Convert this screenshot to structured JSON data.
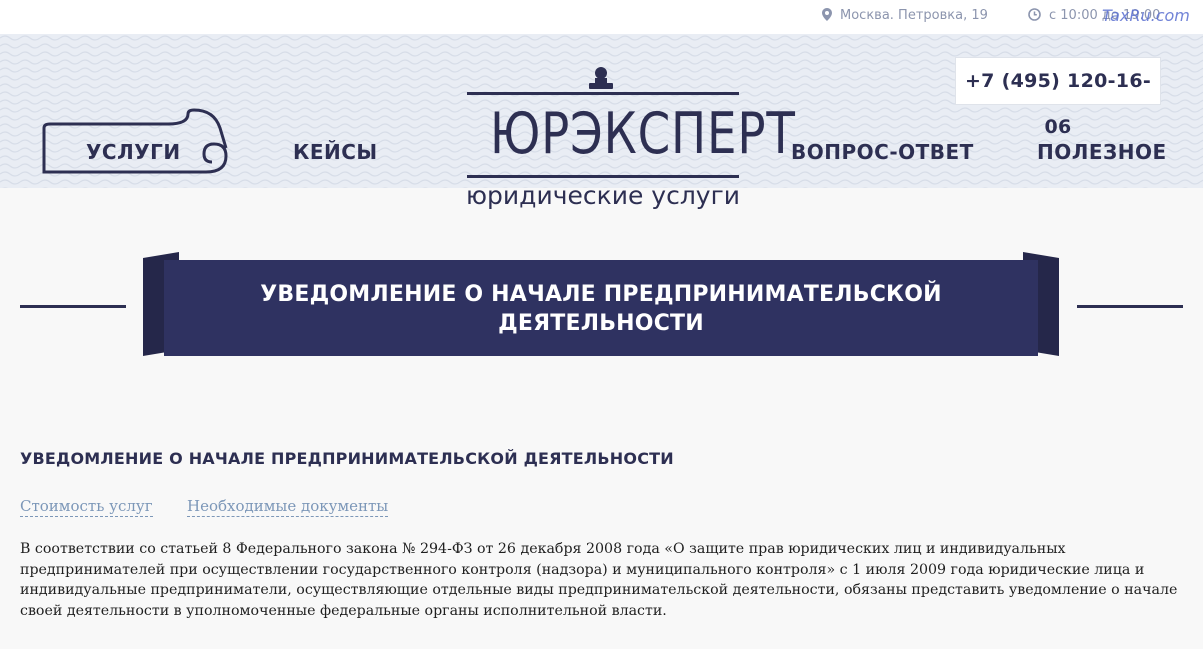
{
  "topbar": {
    "address": "Москва. Петровка, 19",
    "address_icon": "map-pin-icon",
    "hours": "с 10:00 до 19:00",
    "hours_icon": "clock-icon",
    "watermark": "TaxRu.com"
  },
  "header": {
    "phone": "+7 (495) 120-16-06",
    "nav": {
      "services": "УСЛУГИ",
      "cases": "КЕЙСЫ",
      "faq": "ВОПРОС-ОТВЕТ",
      "useful": "ПОЛЕЗНОЕ"
    },
    "logo": {
      "title": "ЮРЭКСПЕРТ",
      "subtitle": "юридические услуги"
    }
  },
  "banner": {
    "title": "УВЕДОМЛЕНИЕ О НАЧАЛЕ ПРЕДПРИНИМАТЕЛЬСКОЙ ДЕЯТЕЛЬНОСТИ"
  },
  "content": {
    "heading": "УВЕДОМЛЕНИЕ О НАЧАЛЕ ПРЕДПРИНИМАТЕЛЬСКОЙ ДЕЯТЕЛЬНОСТИ",
    "tabs": [
      "Стоимость услуг",
      "Необходимые документы"
    ],
    "paragraph": "В соответствии со статьей 8 Федерального закона № 294-ФЗ от 26 декабря 2008 года «О защите прав юридических лиц и индивидуальных предпринимателей при осуществлении государственного контроля (надзора) и муниципального контроля» с 1 июля 2009 года юридические лица и индивидуальные предприниматели, осуществляющие отдельные виды предпринимательской деятельности, обязаны представить уведомление о начале своей деятельности в уполномоченные федеральные органы исполнительной власти."
  },
  "colors": {
    "brand_navy": "#2d2f52",
    "ribbon": "#2f3261",
    "link": "#7c97b8",
    "band": "#e9edf4"
  }
}
